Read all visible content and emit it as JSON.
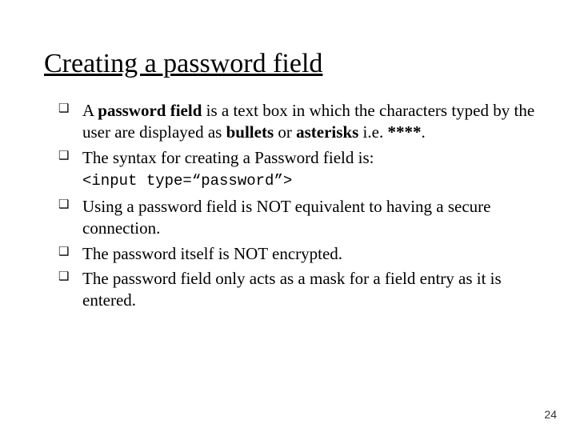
{
  "title": "Creating a password field",
  "bullet1": {
    "pre": "A ",
    "bold1": "password field",
    "mid1": " is a text box in which the characters typed by the user are displayed as ",
    "bold2": "bullets",
    "mid2": " or ",
    "bold3": "asterisks",
    "mid3": " i.e. ",
    "bold4": "****",
    "post": "."
  },
  "bullet2": "The syntax for creating a Password field is:",
  "code": "<input type=“password”>",
  "bullet3": "Using a password field is NOT equivalent to having a secure connection.",
  "bullet4": "The password itself is NOT encrypted.",
  "bullet5": "The password field only acts as a mask for a field entry as it is entered.",
  "page_number": "24"
}
